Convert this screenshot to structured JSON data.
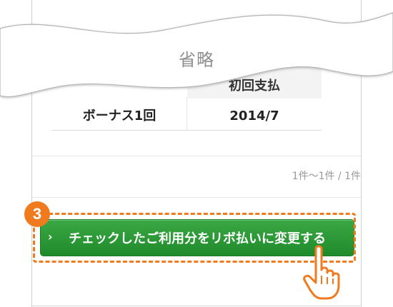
{
  "table": {
    "header_label": "初回支払",
    "row": {
      "type": "ボーナス1回",
      "first_payment": "2014/7"
    }
  },
  "omitted_label": "省略",
  "pagination": {
    "text": "1件〜1件 / 1件"
  },
  "cta": {
    "label": "チェックしたご利用分をリボ払いに変更する",
    "arrow": "›"
  },
  "step_badge": "3",
  "colors": {
    "accent_orange": "#f07a1e",
    "button_green": "#2b9a35"
  },
  "icons": {
    "pointer": "pointing-hand-icon"
  }
}
